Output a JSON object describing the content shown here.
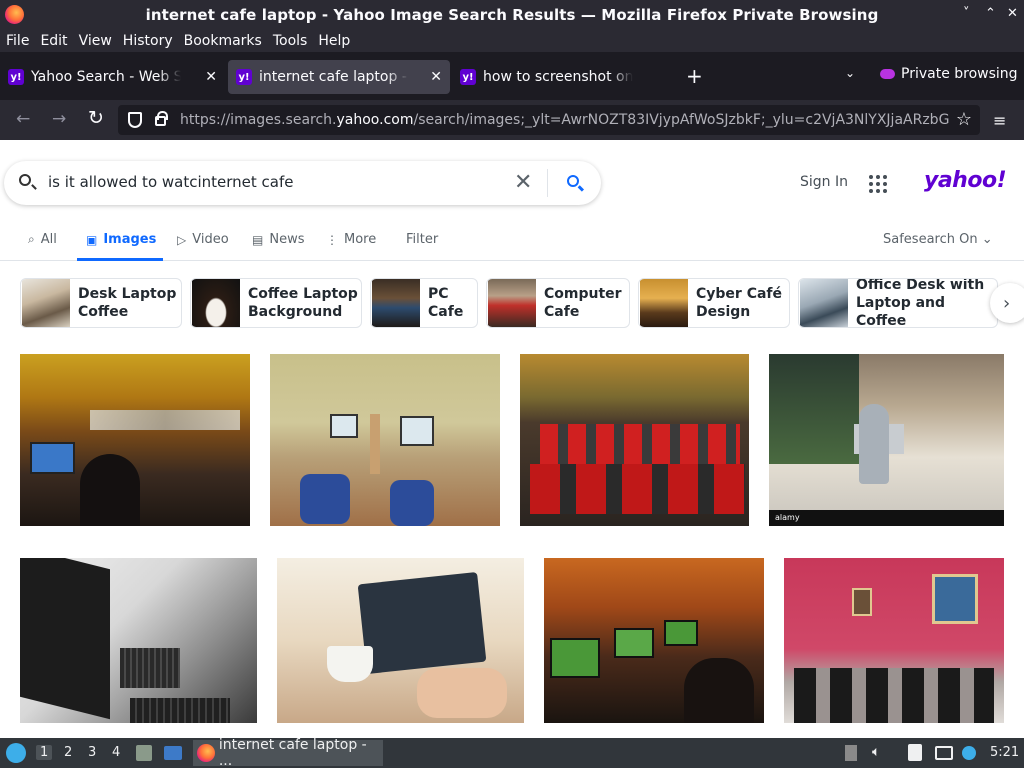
{
  "window": {
    "title": "internet cafe laptop - Yahoo Image Search Results — Mozilla Firefox Private Browsing",
    "controls": [
      "˅",
      "⌃",
      "✕"
    ]
  },
  "menu": [
    "File",
    "Edit",
    "View",
    "History",
    "Bookmarks",
    "Tools",
    "Help"
  ],
  "tabs": [
    {
      "label": "Yahoo Search - Web Search",
      "fav": "y!"
    },
    {
      "label": "internet cafe laptop - Yahoo",
      "fav": "y!"
    },
    {
      "label": "how to screenshot on windows",
      "fav": "y!"
    }
  ],
  "tabbar": {
    "new_tab": "+",
    "list_all": "⌄",
    "private_label": "Private browsing"
  },
  "nav": {
    "back": "←",
    "forward": "→",
    "reload": "↻",
    "url_prefix": "https://images.search.",
    "url_domain": "yahoo.com",
    "url_rest": "/search/images;_ylt=AwrNOZT83IVjypAfWoSJzbkF;_ylu=c2VjA3NlYXJjaARzbG",
    "star": "☆",
    "menu": "≡"
  },
  "search": {
    "query": "is it allowed to watcinternet cafe",
    "clear": "✕",
    "sign_in": "Sign In",
    "logo": "yahoo!"
  },
  "search_tabs": [
    {
      "label": "All",
      "icon": "⌕"
    },
    {
      "label": "Images",
      "icon": "▣"
    },
    {
      "label": "Video",
      "icon": "▷"
    },
    {
      "label": "News",
      "icon": "▤"
    },
    {
      "label": "More",
      "icon": "⋮"
    },
    {
      "label": "Filter",
      "icon": ""
    }
  ],
  "safesearch": "Safesearch On ⌄",
  "chips": [
    {
      "line1": "Desk Laptop",
      "line2": "Coffee"
    },
    {
      "line1": "Coffee Laptop",
      "line2": "Background"
    },
    {
      "line1": "PC",
      "line2": "Cafe"
    },
    {
      "line1": "Computer",
      "line2": "Cafe"
    },
    {
      "line1": "Cyber Café",
      "line2": "Design"
    },
    {
      "line1": "Office Desk with",
      "line2": "Laptop and Coffee"
    }
  ],
  "chip_next": "›",
  "results": [
    {
      "id": "r1",
      "watermark": ""
    },
    {
      "id": "r2",
      "watermark": ""
    },
    {
      "id": "r3",
      "watermark": ""
    },
    {
      "id": "r4",
      "watermark": "alamy"
    },
    {
      "id": "r5",
      "watermark": ""
    },
    {
      "id": "r6",
      "watermark": ""
    },
    {
      "id": "r7",
      "watermark": ""
    },
    {
      "id": "r8",
      "watermark": ""
    }
  ],
  "taskbar": {
    "desktops": [
      "1",
      "2",
      "3",
      "4"
    ],
    "active_window": "internet cafe laptop - ...",
    "clock": "5:21"
  }
}
